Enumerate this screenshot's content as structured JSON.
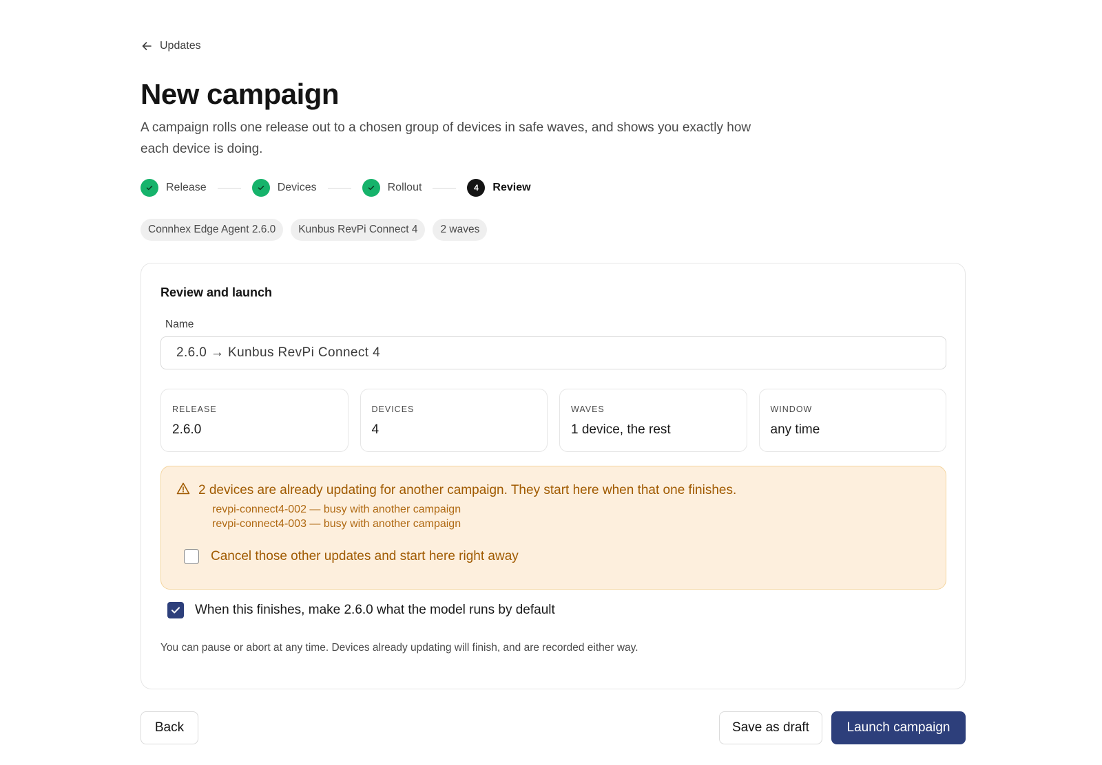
{
  "nav": {
    "back_label": "Updates"
  },
  "header": {
    "title": "New campaign",
    "subtitle": "A campaign rolls one release out to a chosen group of devices in safe waves, and shows you exactly how each device is doing."
  },
  "stepper": {
    "steps": [
      {
        "label": "Release",
        "state": "done"
      },
      {
        "label": "Devices",
        "state": "done"
      },
      {
        "label": "Rollout",
        "state": "done"
      },
      {
        "label": "Review",
        "state": "current",
        "number": "4"
      }
    ]
  },
  "chips": [
    "Connhex Edge Agent 2.6.0",
    "Kunbus RevPi Connect 4",
    "2 waves"
  ],
  "review": {
    "title": "Review and launch",
    "name_label": "Name",
    "name_value": "2.6.0 → Kunbus RevPi Connect 4",
    "summary": [
      {
        "label": "RELEASE",
        "value": "2.6.0"
      },
      {
        "label": "DEVICES",
        "value": "4"
      },
      {
        "label": "WAVES",
        "value": "1 device, the rest"
      },
      {
        "label": "WINDOW",
        "value": "any time"
      }
    ],
    "warning": {
      "message": "2 devices are already updating for another campaign. They start here when that one finishes.",
      "devices": [
        "revpi-connect4-002 — busy with another campaign",
        "revpi-connect4-003 — busy with another campaign"
      ],
      "cancel_label": "Cancel those other updates and start here right away",
      "cancel_checked": false
    },
    "default_label": "When this finishes, make 2.6.0 what the model runs by default",
    "default_checked": true,
    "footnote": "You can pause or abort at any time. Devices already updating will finish, and are recorded either way."
  },
  "actions": {
    "back": "Back",
    "save_draft": "Save as draft",
    "launch": "Launch campaign"
  },
  "colors": {
    "accent": "#2d3f7b",
    "success": "#16b36b",
    "warning_bg": "#fdefdd",
    "warning_text": "#a05a00"
  }
}
